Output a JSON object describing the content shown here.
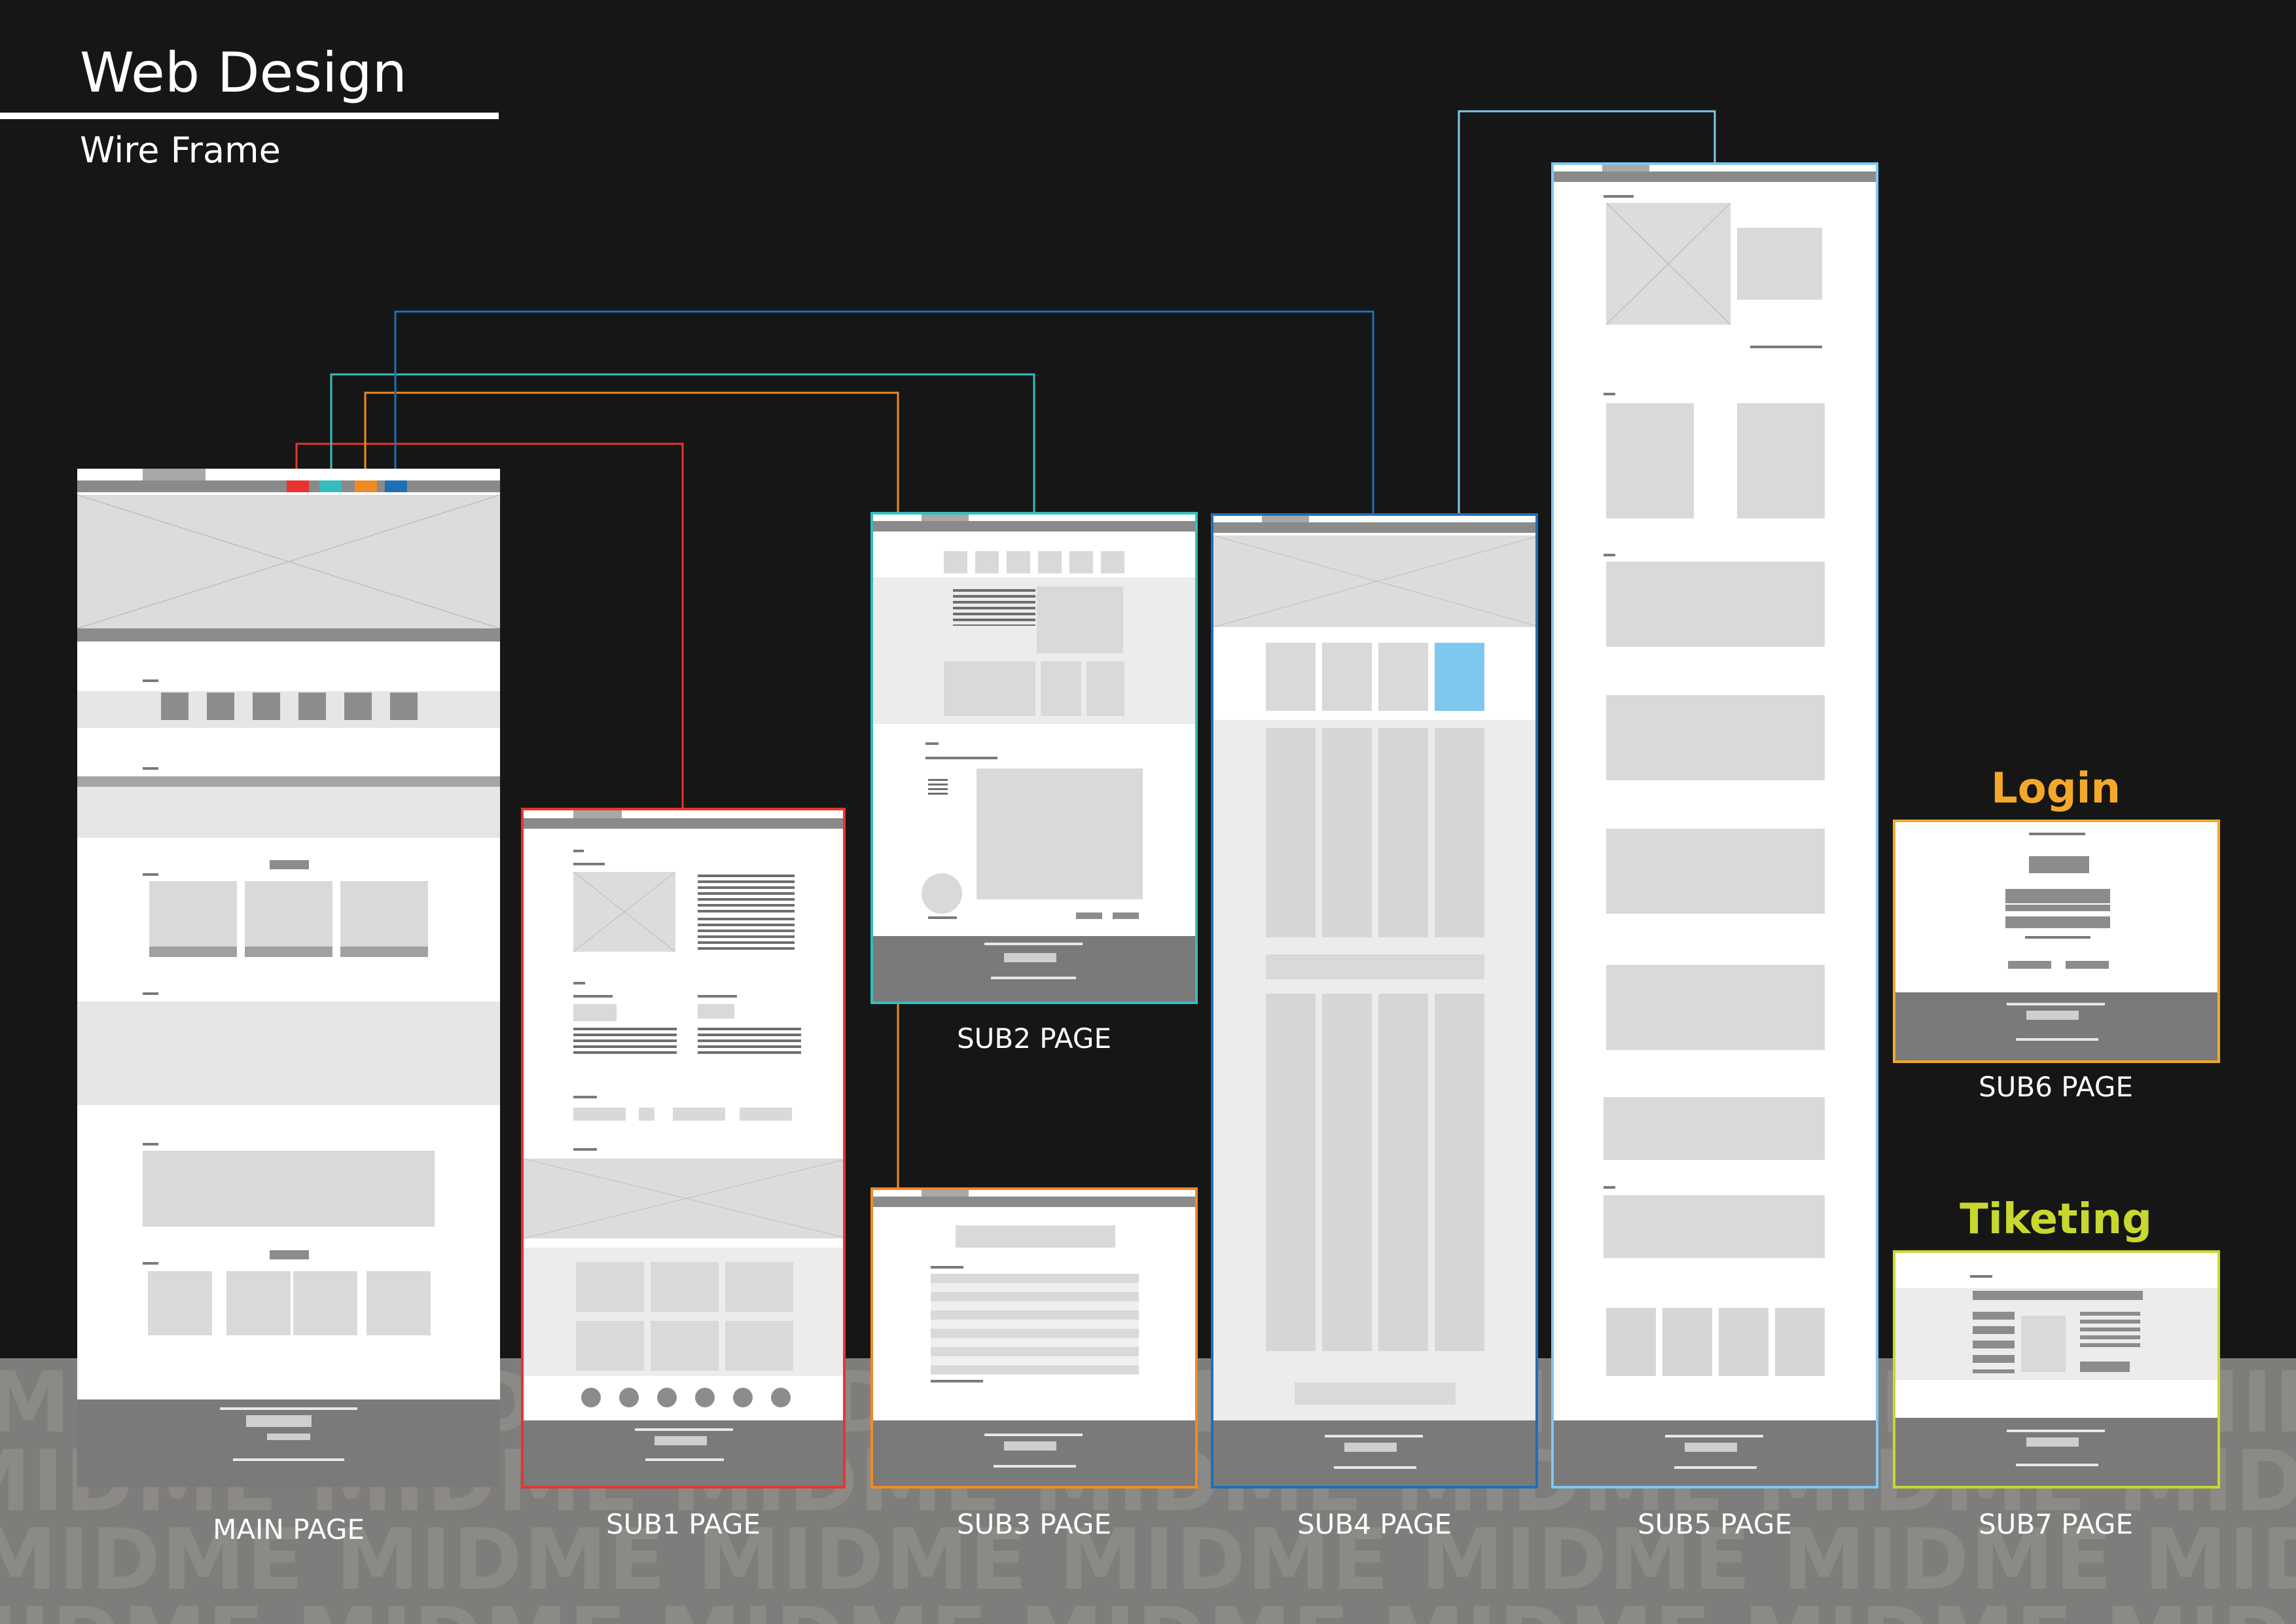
{
  "header": {
    "title": "Web Design",
    "subtitle": "Wire Frame"
  },
  "watermark": {
    "text": "MIDME MIDME MIDME MIDME MIDME MIDME MIDME MIDME MIDME MIDME MIDME MIDME MIDME MIDME MIDME MIDME MIDME MIDME MIDME MIDME MIDME MIDME MIDME MIDME MIDME MIDME MIDME MIDME MIDME MIDME MIDME"
  },
  "sections": {
    "login": "Login",
    "ticketing": "Tiketing"
  },
  "captions": {
    "main": "MAIN PAGE",
    "sub1": "SUB1 PAGE",
    "sub2": "SUB2 PAGE",
    "sub3": "SUB3 PAGE",
    "sub4": "SUB4 PAGE",
    "sub5": "SUB5 PAGE",
    "sub6": "SUB6 PAGE",
    "sub7": "SUB7 PAGE"
  },
  "colors": {
    "background": "#161616",
    "sub1_border": "#e8342f",
    "sub2_border": "#35bdbd",
    "sub3_border": "#f08a24",
    "sub4_border": "#1f6fb8",
    "sub5_border": "#7ec8f0",
    "sub6_border": "#f4a82a",
    "sub7_border": "#c8d82e",
    "login_title": "#f4a82a",
    "ticketing_title": "#c8d82e",
    "highlight_box": "#7ec8f0"
  }
}
